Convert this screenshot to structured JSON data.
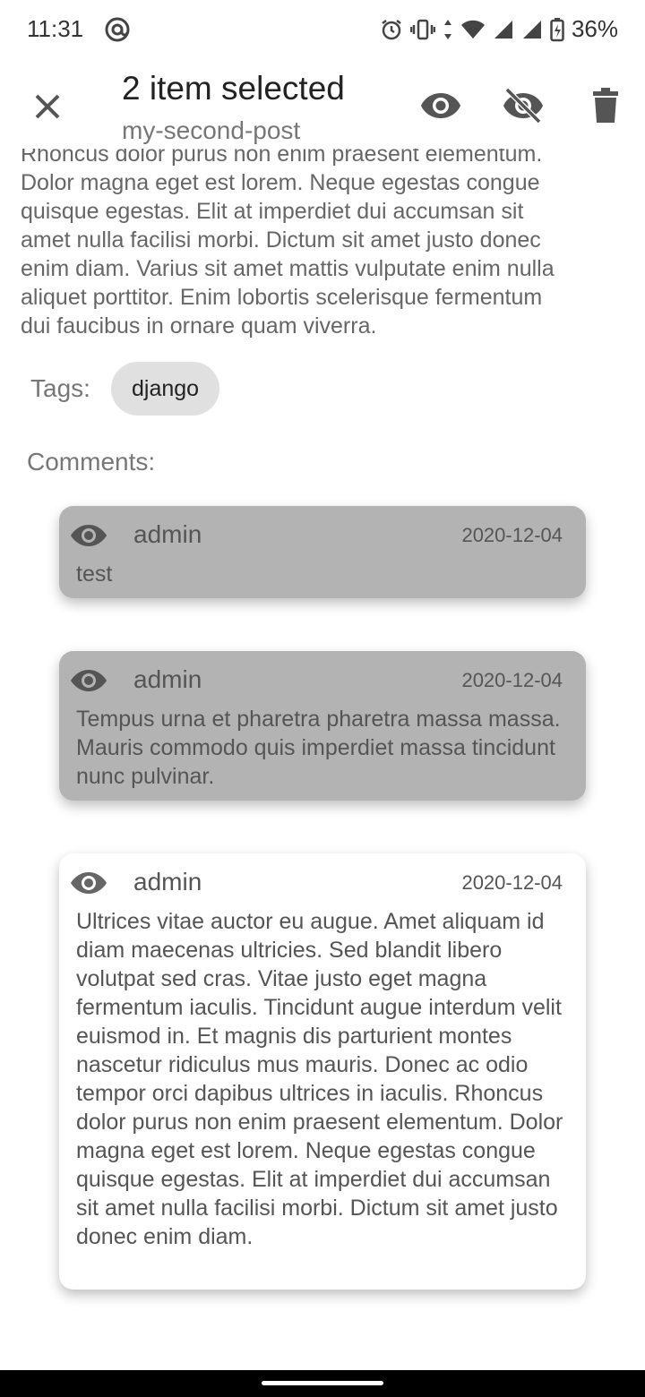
{
  "status_bar": {
    "time": "11:31",
    "battery": "36%",
    "icons": [
      "at-icon",
      "alarm-icon",
      "vibrate-icon",
      "data-arrows-icon",
      "wifi-icon",
      "signal-icon",
      "signal-icon-2",
      "battery-charging-icon"
    ]
  },
  "app_bar": {
    "title": "2 item selected",
    "subtitle": "my-second-post",
    "actions": [
      "close-icon",
      "show-icon",
      "hide-icon",
      "delete-icon"
    ]
  },
  "post": {
    "body_lines": "Rhoncus dolor purus non enim praesent elementum.\nDolor magna eget est lorem. Neque egestas congue\nquisque egestas. Elit at imperdiet dui accumsan sit\namet nulla facilisi morbi. Dictum sit amet justo donec\nenim diam. Varius sit amet mattis vulputate enim nulla\naliquet porttitor. Enim lobortis scelerisque fermentum\ndui faucibus in ornare quam viverra.",
    "tags_label": "Tags:",
    "tags": [
      "django"
    ],
    "comments_label": "Comments:"
  },
  "comments": [
    {
      "author": "admin",
      "date": "2020-12-04",
      "text": "test",
      "selected": true
    },
    {
      "author": "admin",
      "date": "2020-12-04",
      "text": "Tempus urna et pharetra pharetra massa massa. Mauris commodo quis imperdiet massa tincidunt nunc pulvinar.",
      "selected": true
    },
    {
      "author": "admin",
      "date": "2020-12-04",
      "text": "Ultrices vitae auctor eu augue. Amet aliquam id diam maecenas ultricies. Sed blandit libero volutpat sed cras. Vitae justo eget magna fermentum iaculis. Tincidunt augue interdum velit euismod in. Et magnis dis parturient montes nascetur ridiculus mus mauris. Donec ac odio tempor orci dapibus ultrices in iaculis. Rhoncus dolor purus non enim praesent elementum. Dolor magna eget est lorem. Neque egestas congue quisque egestas. Elit at imperdiet dui accumsan sit amet nulla facilisi morbi. Dictum sit amet justo donec enim diam.",
      "selected": false
    }
  ],
  "colors": {
    "selected_card": "#b3b3b3",
    "normal_card": "#ffffff",
    "chip": "#e0e0e0"
  }
}
